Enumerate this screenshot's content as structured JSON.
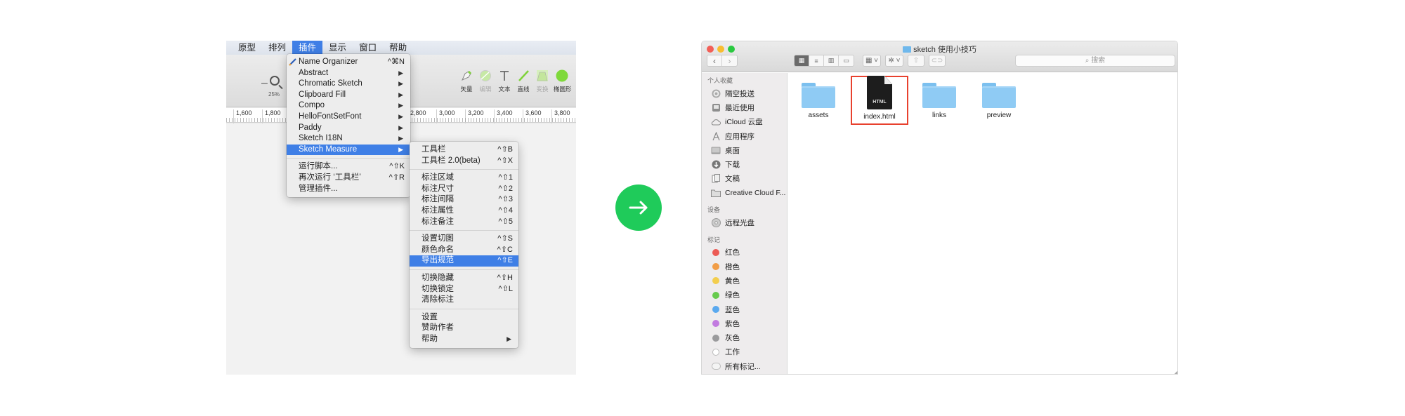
{
  "sketch": {
    "menubar": [
      "原型",
      "排列",
      "插件",
      "显示",
      "窗口",
      "帮助"
    ],
    "active_menu_index": 2,
    "zoom_level": "25%",
    "tools": [
      {
        "label": "矢量",
        "icon": "vector-pen-icon",
        "enabled": true
      },
      {
        "label": "编辑",
        "icon": "edit-icon",
        "enabled": false
      },
      {
        "label": "文本",
        "icon": "text-icon",
        "enabled": true
      },
      {
        "label": "直线",
        "icon": "line-icon",
        "enabled": true
      },
      {
        "label": "变换",
        "icon": "transform-icon",
        "enabled": false
      },
      {
        "label": "椭圆形",
        "icon": "oval-icon",
        "enabled": true
      }
    ],
    "ruler_ticks": [
      "1,600",
      "1,800",
      "2,800",
      "3,000",
      "3,200",
      "3,400",
      "3,600",
      "3,800"
    ],
    "plugins_menu": {
      "items": [
        {
          "label": "Name Organizer",
          "shortcut": "^⌘N",
          "icon": "pencil-icon"
        },
        {
          "label": "Abstract",
          "submenu": true
        },
        {
          "label": "Chromatic Sketch",
          "submenu": true
        },
        {
          "label": "Clipboard Fill",
          "submenu": true
        },
        {
          "label": "Compo",
          "submenu": true
        },
        {
          "label": "HelloFontSetFont",
          "submenu": true
        },
        {
          "label": "Paddy",
          "submenu": true
        },
        {
          "label": "Sketch I18N",
          "submenu": true
        },
        {
          "label": "Sketch Measure",
          "submenu": true,
          "highlighted": true
        }
      ],
      "footer_items": [
        {
          "label": "运行脚本...",
          "shortcut": "^⇧K"
        },
        {
          "label": "再次运行 ‘工具栏’",
          "shortcut": "^⇧R"
        },
        {
          "label": "管理插件..."
        }
      ]
    },
    "measure_submenu": {
      "groups": [
        [
          {
            "label": "工具栏",
            "shortcut": "^⇧B"
          },
          {
            "label": "工具栏 2.0(beta)",
            "shortcut": "^⇧X"
          }
        ],
        [
          {
            "label": "标注区域",
            "shortcut": "^⇧1"
          },
          {
            "label": "标注尺寸",
            "shortcut": "^⇧2"
          },
          {
            "label": "标注间隔",
            "shortcut": "^⇧3"
          },
          {
            "label": "标注属性",
            "shortcut": "^⇧4"
          },
          {
            "label": "标注备注",
            "shortcut": "^⇧5"
          }
        ],
        [
          {
            "label": "设置切图",
            "shortcut": "^⇧S"
          },
          {
            "label": "颜色命名",
            "shortcut": "^⇧C"
          },
          {
            "label": "导出规范",
            "shortcut": "^⇧E",
            "highlighted": true
          }
        ],
        [
          {
            "label": "切换隐藏",
            "shortcut": "^⇧H"
          },
          {
            "label": "切换锁定",
            "shortcut": "^⇧L"
          },
          {
            "label": "清除标注"
          }
        ],
        [
          {
            "label": "设置"
          },
          {
            "label": "赞助作者"
          },
          {
            "label": "帮助",
            "submenu": true
          }
        ]
      ]
    }
  },
  "arrow": {
    "icon": "arrow-right-icon",
    "color": "#1fcb5a"
  },
  "finder": {
    "title": "sketch 使用小技巧",
    "search_placeholder": "搜索",
    "search_icon": "⌕",
    "sidebar": {
      "favorites_header": "个人收藏",
      "favorites": [
        {
          "label": "隔空投送",
          "icon": "airdrop-icon"
        },
        {
          "label": "最近使用",
          "icon": "recents-icon"
        },
        {
          "label": "iCloud 云盘",
          "icon": "icloud-icon"
        },
        {
          "label": "应用程序",
          "icon": "applications-icon"
        },
        {
          "label": "桌面",
          "icon": "desktop-icon"
        },
        {
          "label": "下载",
          "icon": "downloads-icon"
        },
        {
          "label": "文稿",
          "icon": "documents-icon"
        },
        {
          "label": "Creative Cloud F...",
          "icon": "folder-icon"
        }
      ],
      "devices_header": "设备",
      "devices": [
        {
          "label": "远程光盘",
          "icon": "disc-icon"
        }
      ],
      "tags_header": "标记",
      "tags": [
        {
          "label": "红色",
          "color": "#ec5b55"
        },
        {
          "label": "橙色",
          "color": "#f19d47"
        },
        {
          "label": "黄色",
          "color": "#f3ce4e"
        },
        {
          "label": "绿色",
          "color": "#67cb4e"
        },
        {
          "label": "蓝色",
          "color": "#5aa9ef"
        },
        {
          "label": "紫色",
          "color": "#c27be0"
        },
        {
          "label": "灰色",
          "color": "#9a9a9c"
        },
        {
          "label": "工作",
          "color": "#ffffff"
        },
        {
          "label": "所有标记...",
          "color": "#ffffff"
        }
      ]
    },
    "files": [
      {
        "name": "assets",
        "type": "folder"
      },
      {
        "name": "index.html",
        "type": "html",
        "badge": "HTML",
        "selected": true
      },
      {
        "name": "links",
        "type": "folder"
      },
      {
        "name": "preview",
        "type": "folder"
      }
    ],
    "selection_color": "#e8412e"
  }
}
